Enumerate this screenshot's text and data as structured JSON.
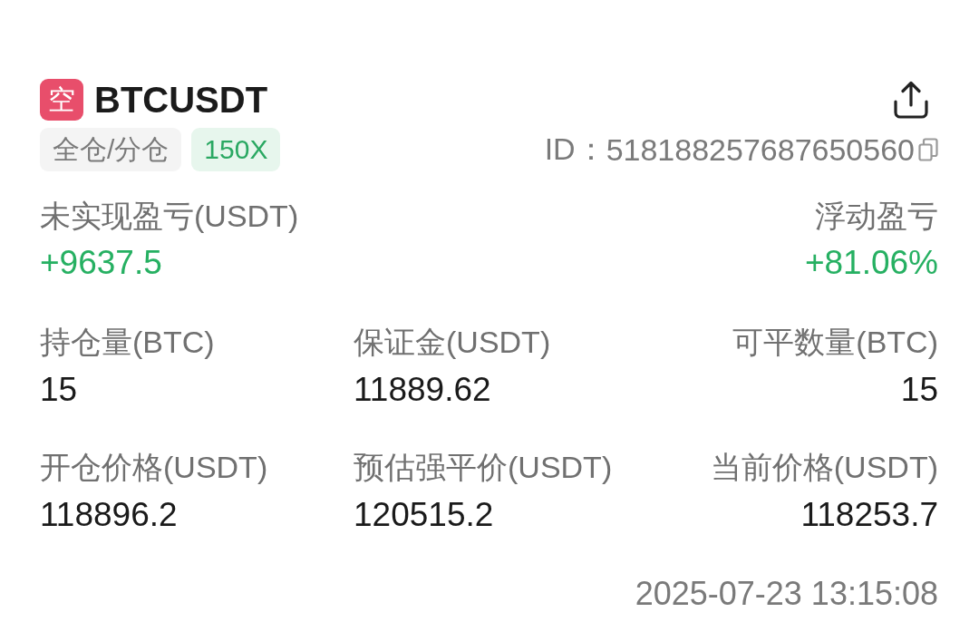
{
  "position": {
    "side_badge": "空",
    "symbol": "BTCUSDT"
  },
  "tags": [
    {
      "label": "全仓/分仓",
      "kind": "margin_mode"
    },
    {
      "label": "150X",
      "kind": "leverage"
    }
  ],
  "order_id": {
    "label": "ID：",
    "value": "518188257687650560"
  },
  "pnl": [
    {
      "label": "未实现盈亏(USDT)",
      "value": "+9637.5",
      "positive": true
    },
    {
      "label": "浮动盈亏",
      "value": "+81.06%",
      "positive": true
    }
  ],
  "details": [
    {
      "label": "持仓量(BTC)",
      "value": "15"
    },
    {
      "label": "保证金(USDT)",
      "value": "11889.62"
    },
    {
      "label": "可平数量(BTC)",
      "value": "15"
    },
    {
      "label": "开仓价格(USDT)",
      "value": "118896.2"
    },
    {
      "label": "预估强平价(USDT)",
      "value": "120515.2"
    },
    {
      "label": "当前价格(USDT)",
      "value": "118253.7"
    }
  ],
  "timestamp": "2025-07-23 13:15:08"
}
